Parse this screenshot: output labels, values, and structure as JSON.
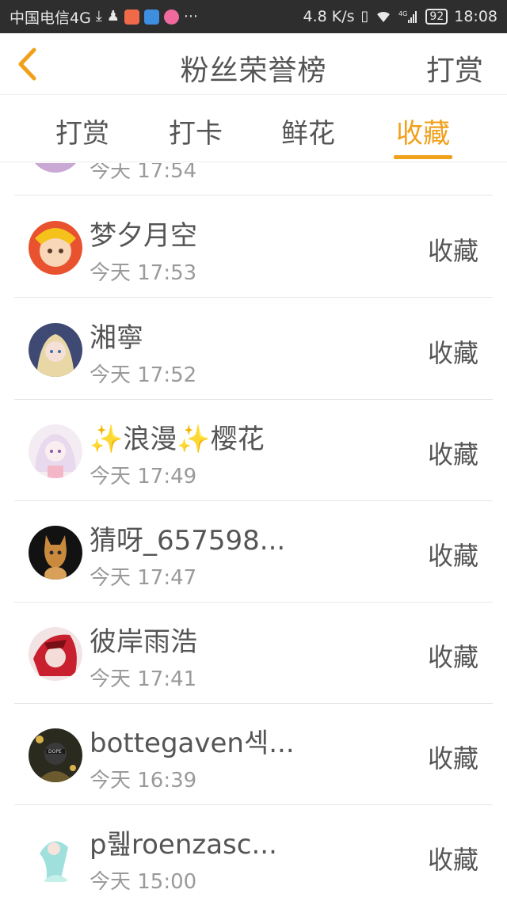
{
  "status_bar": {
    "carrier": "中国电信4G",
    "speed": "4.8 K/s",
    "network": "4G",
    "battery": "92",
    "time": "18:08"
  },
  "header": {
    "title": "粉丝荣誉榜",
    "action": "打赏",
    "back_icon": "chevron-left-icon",
    "accent_color": "#f0a01b"
  },
  "tabs": [
    {
      "label": "打赏",
      "active": false
    },
    {
      "label": "打卡",
      "active": false
    },
    {
      "label": "鲜花",
      "active": false
    },
    {
      "label": "收藏",
      "active": true
    }
  ],
  "list": {
    "partial_row": {
      "time": "今天 17:54"
    },
    "items": [
      {
        "name": "梦夕月空",
        "time": "今天 17:53",
        "action": "收藏"
      },
      {
        "name": "湘寧",
        "time": "今天 17:52",
        "action": "收藏"
      },
      {
        "name_prefix": "✨",
        "name_part1": "浪漫",
        "name_mid": "✨",
        "name_part2": "樱花",
        "time": "今天 17:49",
        "action": "收藏"
      },
      {
        "name": "猜呀_657598...",
        "time": "今天 17:47",
        "action": "收藏"
      },
      {
        "name": "彼岸雨浩",
        "time": "今天 17:41",
        "action": "收藏"
      },
      {
        "name": "bottegaven섹...",
        "time": "今天 16:39",
        "action": "收藏"
      },
      {
        "name": "p뤮roenzasc...",
        "time": "今天 15:00",
        "action": "收藏"
      }
    ]
  }
}
